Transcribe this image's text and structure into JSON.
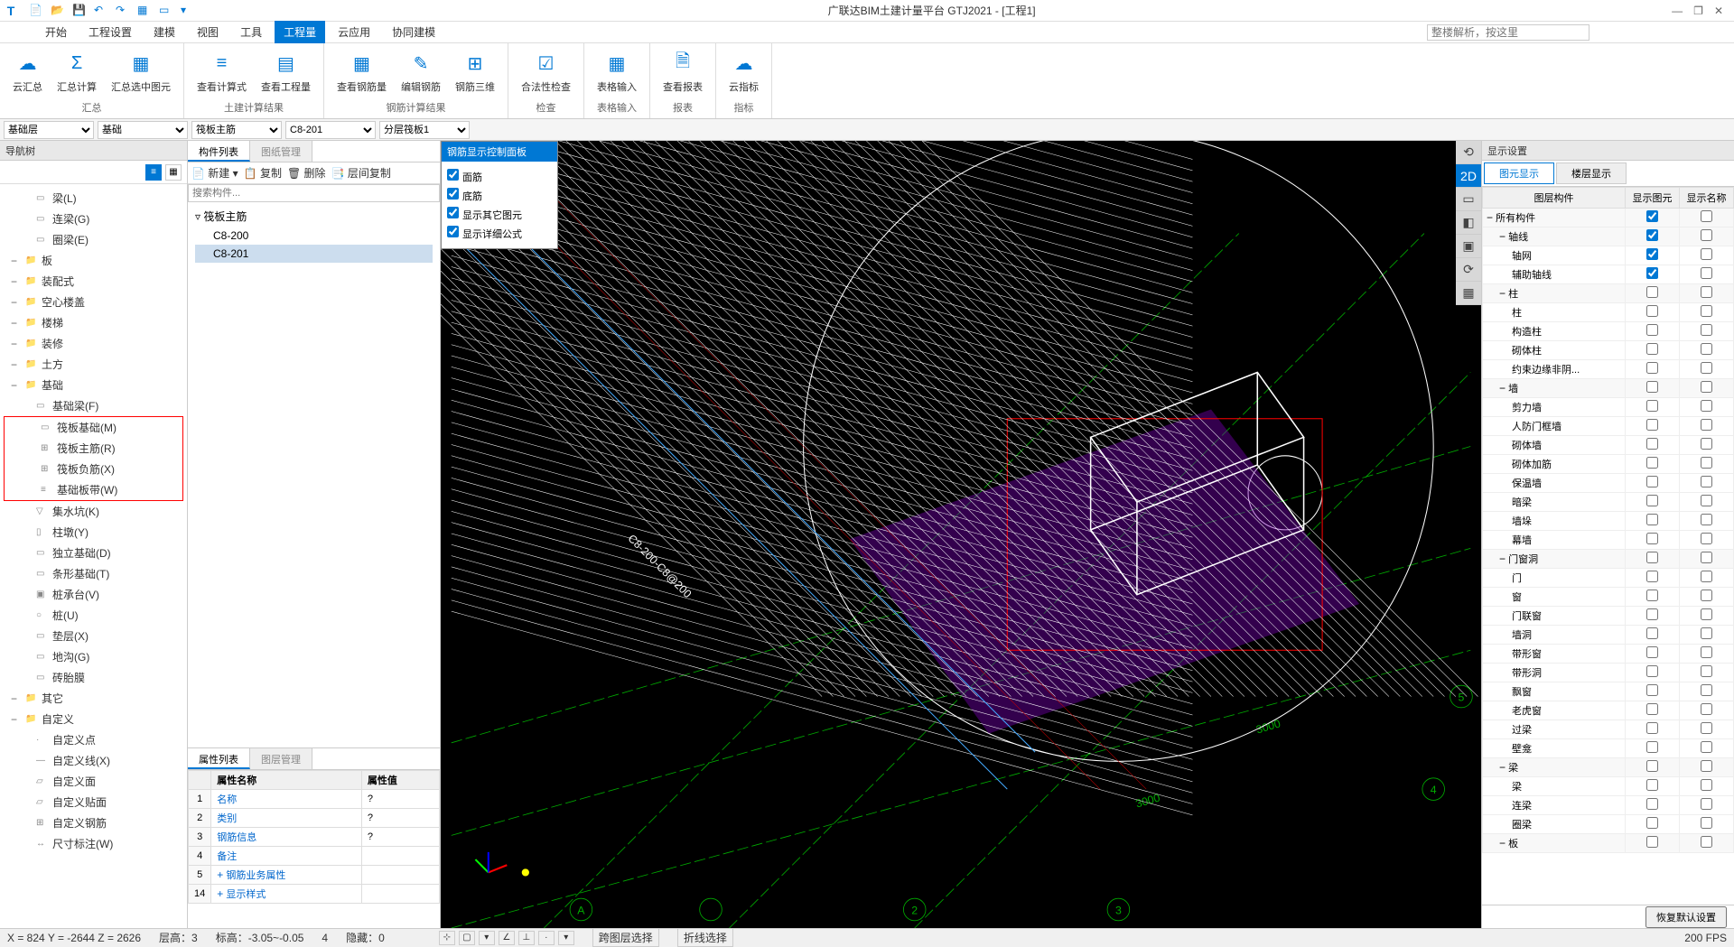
{
  "app": {
    "title": "广联达BIM土建计量平台 GTJ2021 - [工程1]",
    "search_placeholder": "整楼解析，按这里"
  },
  "menu": [
    "开始",
    "工程设置",
    "建模",
    "视图",
    "工具",
    "工程量",
    "云应用",
    "协同建模"
  ],
  "menu_active_index": 5,
  "ribbon": {
    "groups": [
      {
        "label": "汇总",
        "buttons": [
          {
            "label": "云汇总",
            "icon": "☁"
          },
          {
            "label": "汇总计算",
            "icon": "Σ"
          },
          {
            "label": "汇总选中图元",
            "icon": "▦"
          }
        ]
      },
      {
        "label": "土建计算结果",
        "buttons": [
          {
            "label": "查看计算式",
            "icon": "≡"
          },
          {
            "label": "查看工程量",
            "icon": "▤"
          }
        ]
      },
      {
        "label": "钢筋计算结果",
        "buttons": [
          {
            "label": "查看钢筋量",
            "icon": "▦"
          },
          {
            "label": "编辑钢筋",
            "icon": "✎"
          },
          {
            "label": "钢筋三维",
            "icon": "⊞"
          }
        ]
      },
      {
        "label": "检查",
        "buttons": [
          {
            "label": "合法性检查",
            "icon": "☑"
          }
        ]
      },
      {
        "label": "表格输入",
        "buttons": [
          {
            "label": "表格输入",
            "icon": "▦"
          }
        ]
      },
      {
        "label": "报表",
        "buttons": [
          {
            "label": "查看报表",
            "icon": "🗎"
          }
        ]
      },
      {
        "label": "指标",
        "buttons": [
          {
            "label": "云指标",
            "icon": "☁"
          }
        ]
      }
    ]
  },
  "selectors": [
    "基础层",
    "基础",
    "筏板主筋",
    "C8-201",
    "分层筏板1"
  ],
  "nav": {
    "title": "导航树",
    "items": [
      {
        "label": "梁(L)",
        "indent": 2,
        "icon": "▭"
      },
      {
        "label": "连梁(G)",
        "indent": 2,
        "icon": "▭"
      },
      {
        "label": "圈梁(E)",
        "indent": 2,
        "icon": "▭"
      },
      {
        "label": "板",
        "indent": 0,
        "toggle": "−",
        "cat": true
      },
      {
        "label": "装配式",
        "indent": 0,
        "toggle": "−",
        "cat": true
      },
      {
        "label": "空心楼盖",
        "indent": 0,
        "toggle": "−",
        "cat": true
      },
      {
        "label": "楼梯",
        "indent": 0,
        "toggle": "−",
        "cat": true
      },
      {
        "label": "装修",
        "indent": 0,
        "toggle": "−",
        "cat": true
      },
      {
        "label": "土方",
        "indent": 0,
        "toggle": "−",
        "cat": true
      },
      {
        "label": "基础",
        "indent": 0,
        "toggle": "−",
        "cat": true
      },
      {
        "label": "基础梁(F)",
        "indent": 2,
        "icon": "▭"
      },
      {
        "label": "筏板基础(M)",
        "indent": 2,
        "icon": "▭",
        "hl_start": true
      },
      {
        "label": "筏板主筋(R)",
        "indent": 2,
        "icon": "⊞"
      },
      {
        "label": "筏板负筋(X)",
        "indent": 2,
        "icon": "⊞"
      },
      {
        "label": "基础板带(W)",
        "indent": 2,
        "icon": "≡",
        "hl_end": true
      },
      {
        "label": "集水坑(K)",
        "indent": 2,
        "icon": "▽"
      },
      {
        "label": "柱墩(Y)",
        "indent": 2,
        "icon": "▯"
      },
      {
        "label": "独立基础(D)",
        "indent": 2,
        "icon": "▭"
      },
      {
        "label": "条形基础(T)",
        "indent": 2,
        "icon": "▭"
      },
      {
        "label": "桩承台(V)",
        "indent": 2,
        "icon": "▣"
      },
      {
        "label": "桩(U)",
        "indent": 2,
        "icon": "○"
      },
      {
        "label": "垫层(X)",
        "indent": 2,
        "icon": "▭"
      },
      {
        "label": "地沟(G)",
        "indent": 2,
        "icon": "▭"
      },
      {
        "label": "砖胎膜",
        "indent": 2,
        "icon": "▭"
      },
      {
        "label": "其它",
        "indent": 0,
        "toggle": "−",
        "cat": true
      },
      {
        "label": "自定义",
        "indent": 0,
        "toggle": "−",
        "cat": true
      },
      {
        "label": "自定义点",
        "indent": 2,
        "icon": "·"
      },
      {
        "label": "自定义线(X)",
        "indent": 2,
        "icon": "—"
      },
      {
        "label": "自定义面",
        "indent": 2,
        "icon": "▱"
      },
      {
        "label": "自定义贴面",
        "indent": 2,
        "icon": "▱"
      },
      {
        "label": "自定义钢筋",
        "indent": 2,
        "icon": "⊞"
      },
      {
        "label": "尺寸标注(W)",
        "indent": 2,
        "icon": "↔"
      }
    ]
  },
  "comp": {
    "tabs": [
      "构件列表",
      "图纸管理"
    ],
    "toolbar": [
      "新建",
      "复制",
      "删除",
      "层间复制"
    ],
    "search_placeholder": "搜索构件...",
    "group": "筏板主筋",
    "items": [
      "C8-200",
      "C8-201"
    ],
    "selected": "C8-201"
  },
  "props": {
    "tabs": [
      "属性列表",
      "图层管理"
    ],
    "headers": [
      "属性名称",
      "属性值"
    ],
    "rows": [
      {
        "idx": "1",
        "name": "名称",
        "val": "?"
      },
      {
        "idx": "2",
        "name": "类别",
        "val": "?"
      },
      {
        "idx": "3",
        "name": "钢筋信息",
        "val": "?"
      },
      {
        "idx": "4",
        "name": "备注",
        "val": ""
      },
      {
        "idx": "5",
        "name": "钢筋业务属性",
        "val": "",
        "exp": "+"
      },
      {
        "idx": "14",
        "name": "显示样式",
        "val": "",
        "exp": "+"
      }
    ]
  },
  "float_panel": {
    "title": "钢筋显示控制面板",
    "checks": [
      "面筋",
      "底筋",
      "显示其它图元",
      "显示详细公式"
    ]
  },
  "display": {
    "title": "显示设置",
    "tabs": [
      "图元显示",
      "楼层显示"
    ],
    "headers": [
      "图层构件",
      "显示图元",
      "显示名称"
    ],
    "rows": [
      {
        "label": "所有构件",
        "cat": true,
        "c1": true,
        "c2": false,
        "toggle": "−"
      },
      {
        "label": "轴线",
        "cat": true,
        "c1": true,
        "c2": false,
        "toggle": "−",
        "indent": 1
      },
      {
        "label": "轴网",
        "c1": true,
        "c2": false,
        "indent": 2
      },
      {
        "label": "辅助轴线",
        "c1": true,
        "c2": false,
        "indent": 2
      },
      {
        "label": "柱",
        "cat": true,
        "c1": false,
        "c2": false,
        "toggle": "−",
        "indent": 1
      },
      {
        "label": "柱",
        "c1": false,
        "c2": false,
        "indent": 2
      },
      {
        "label": "构造柱",
        "c1": false,
        "c2": false,
        "indent": 2
      },
      {
        "label": "砌体柱",
        "c1": false,
        "c2": false,
        "indent": 2
      },
      {
        "label": "约束边缘非阴...",
        "c1": false,
        "c2": false,
        "indent": 2
      },
      {
        "label": "墙",
        "cat": true,
        "c1": false,
        "c2": false,
        "toggle": "−",
        "indent": 1
      },
      {
        "label": "剪力墙",
        "c1": false,
        "c2": false,
        "indent": 2
      },
      {
        "label": "人防门框墙",
        "c1": false,
        "c2": false,
        "indent": 2
      },
      {
        "label": "砌体墙",
        "c1": false,
        "c2": false,
        "indent": 2
      },
      {
        "label": "砌体加筋",
        "c1": false,
        "c2": false,
        "indent": 2
      },
      {
        "label": "保温墙",
        "c1": false,
        "c2": false,
        "indent": 2
      },
      {
        "label": "暗梁",
        "c1": false,
        "c2": false,
        "indent": 2
      },
      {
        "label": "墙垛",
        "c1": false,
        "c2": false,
        "indent": 2
      },
      {
        "label": "幕墙",
        "c1": false,
        "c2": false,
        "indent": 2
      },
      {
        "label": "门窗洞",
        "cat": true,
        "c1": false,
        "c2": false,
        "toggle": "−",
        "indent": 1
      },
      {
        "label": "门",
        "c1": false,
        "c2": false,
        "indent": 2
      },
      {
        "label": "窗",
        "c1": false,
        "c2": false,
        "indent": 2
      },
      {
        "label": "门联窗",
        "c1": false,
        "c2": false,
        "indent": 2
      },
      {
        "label": "墙洞",
        "c1": false,
        "c2": false,
        "indent": 2
      },
      {
        "label": "带形窗",
        "c1": false,
        "c2": false,
        "indent": 2
      },
      {
        "label": "带形洞",
        "c1": false,
        "c2": false,
        "indent": 2
      },
      {
        "label": "飘窗",
        "c1": false,
        "c2": false,
        "indent": 2
      },
      {
        "label": "老虎窗",
        "c1": false,
        "c2": false,
        "indent": 2
      },
      {
        "label": "过梁",
        "c1": false,
        "c2": false,
        "indent": 2
      },
      {
        "label": "壁龛",
        "c1": false,
        "c2": false,
        "indent": 2
      },
      {
        "label": "梁",
        "cat": true,
        "c1": false,
        "c2": false,
        "toggle": "−",
        "indent": 1
      },
      {
        "label": "梁",
        "c1": false,
        "c2": false,
        "indent": 2
      },
      {
        "label": "连梁",
        "c1": false,
        "c2": false,
        "indent": 2
      },
      {
        "label": "圈梁",
        "c1": false,
        "c2": false,
        "indent": 2
      },
      {
        "label": "板",
        "cat": true,
        "c1": false,
        "c2": false,
        "toggle": "−",
        "indent": 1
      }
    ],
    "reset_btn": "恢复默认设置"
  },
  "status": {
    "coords": "X = 824 Y = -2644 Z = 2626",
    "floor": "层高：3",
    "elev": "标高：-3.05~-0.05",
    "num": "4",
    "hidden": "隐藏：0",
    "cross": "跨图层选择",
    "poly": "折线选择",
    "fps": "200 FPS"
  },
  "viewport_labels": {
    "d1": "3000",
    "d2": "3000",
    "a": "A",
    "n2": "2",
    "n3": "3",
    "n4": "4",
    "n5": "5",
    "rebar": "C8-200-C8@200"
  }
}
